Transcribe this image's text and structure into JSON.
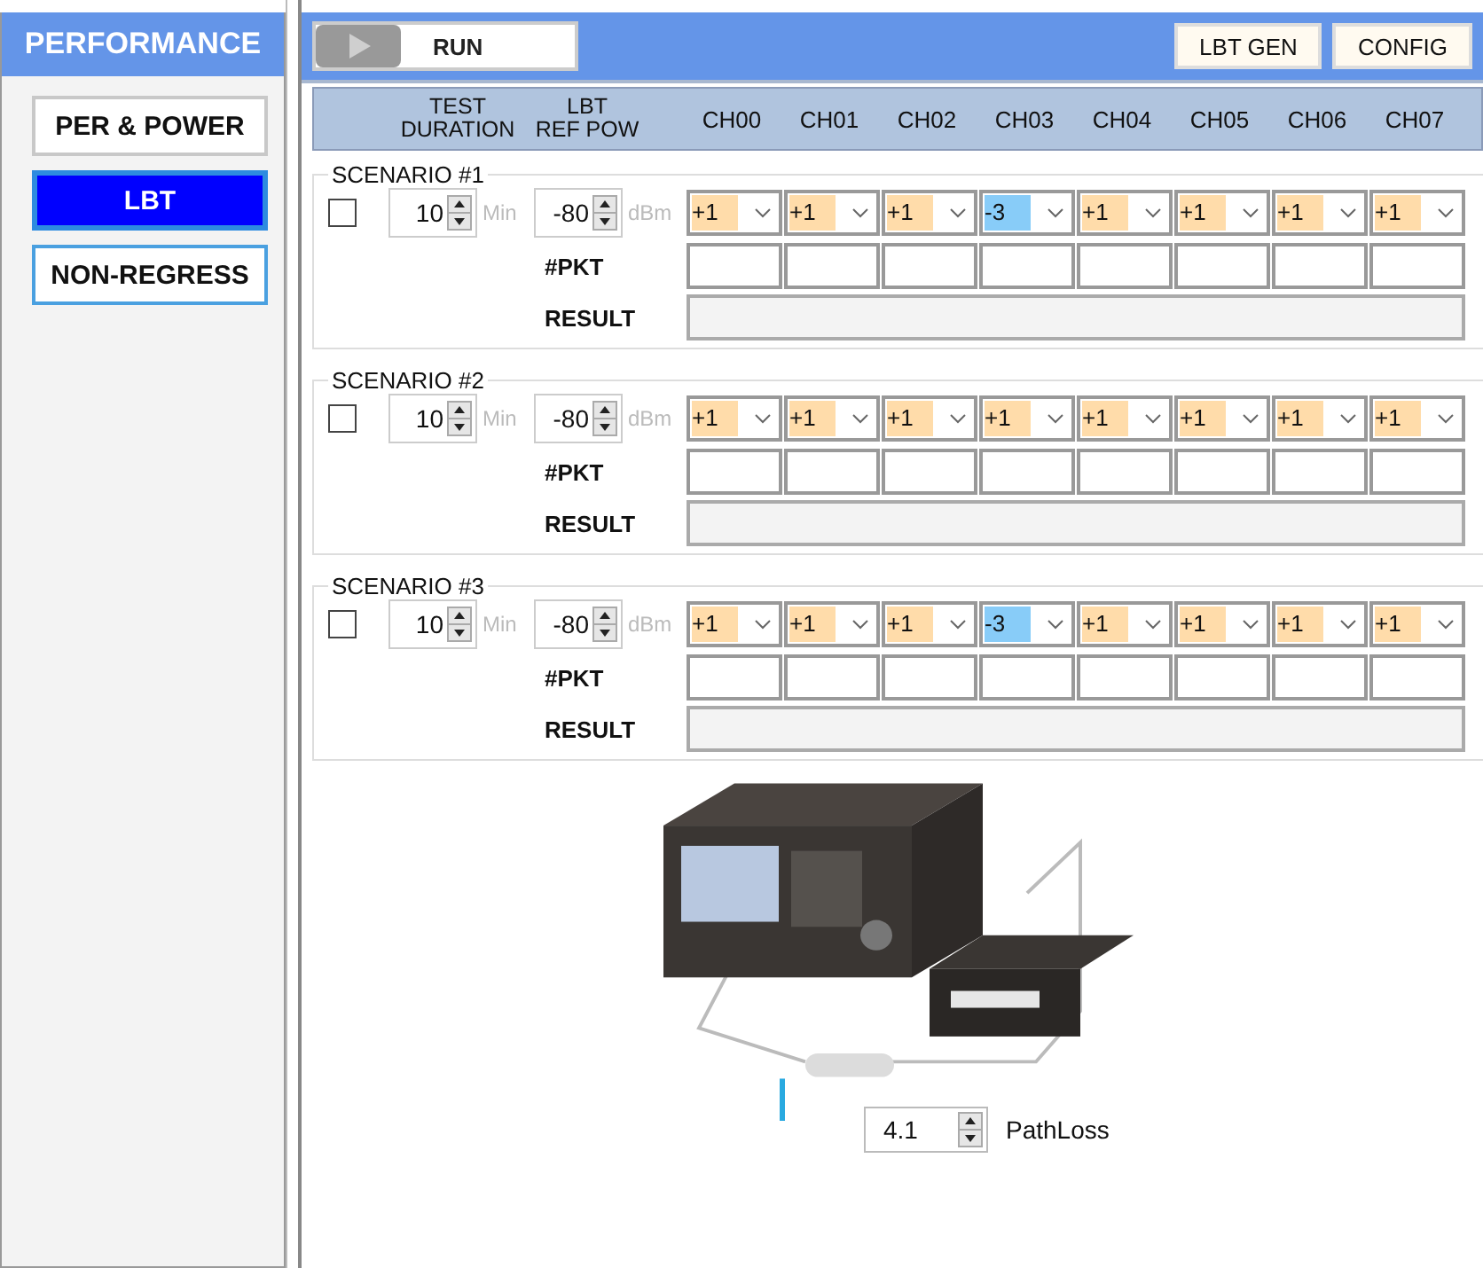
{
  "sidebar": {
    "title": "PERFORMANCE",
    "items": [
      {
        "label": "PER & POWER",
        "selected": false
      },
      {
        "label": "LBT",
        "selected": true
      },
      {
        "label": "NON-REGRESS",
        "selected": false
      }
    ]
  },
  "toolbar": {
    "run_label": "RUN",
    "buttons": [
      "LBT GEN",
      "CONFIG"
    ]
  },
  "header": {
    "duration": "TEST\nDURATION",
    "ref_pow": "LBT\nREF POW",
    "channels": [
      "CH00",
      "CH01",
      "CH02",
      "CH03",
      "CH04",
      "CH05",
      "CH06",
      "CH07"
    ]
  },
  "scenarios": [
    {
      "title": "SCENARIO #1",
      "checked": false,
      "duration": "10",
      "duration_unit": "Min",
      "ref_pow": "-80",
      "ref_unit": "dBm",
      "pkt_label": "#PKT",
      "result_label": "RESULT",
      "channels": [
        {
          "value": "+1",
          "color": "#ffdcaa"
        },
        {
          "value": "+1",
          "color": "#ffdcaa"
        },
        {
          "value": "+1",
          "color": "#ffdcaa"
        },
        {
          "value": "-3",
          "color": "#88ccf8"
        },
        {
          "value": "+1",
          "color": "#ffdcaa"
        },
        {
          "value": "+1",
          "color": "#ffdcaa"
        },
        {
          "value": "+1",
          "color": "#ffdcaa"
        },
        {
          "value": "+1",
          "color": "#ffdcaa"
        }
      ]
    },
    {
      "title": "SCENARIO #2",
      "checked": false,
      "duration": "10",
      "duration_unit": "Min",
      "ref_pow": "-80",
      "ref_unit": "dBm",
      "pkt_label": "#PKT",
      "result_label": "RESULT",
      "channels": [
        {
          "value": "+1",
          "color": "#ffdcaa"
        },
        {
          "value": "+1",
          "color": "#ffdcaa"
        },
        {
          "value": "+1",
          "color": "#ffdcaa"
        },
        {
          "value": "+1",
          "color": "#ffdcaa"
        },
        {
          "value": "+1",
          "color": "#ffdcaa"
        },
        {
          "value": "+1",
          "color": "#ffdcaa"
        },
        {
          "value": "+1",
          "color": "#ffdcaa"
        },
        {
          "value": "+1",
          "color": "#ffdcaa"
        }
      ]
    },
    {
      "title": "SCENARIO #3",
      "checked": false,
      "duration": "10",
      "duration_unit": "Min",
      "ref_pow": "-80",
      "ref_unit": "dBm",
      "pkt_label": "#PKT",
      "result_label": "RESULT",
      "channels": [
        {
          "value": "+1",
          "color": "#ffdcaa"
        },
        {
          "value": "+1",
          "color": "#ffdcaa"
        },
        {
          "value": "+1",
          "color": "#ffdcaa"
        },
        {
          "value": "-3",
          "color": "#88ccf8"
        },
        {
          "value": "+1",
          "color": "#ffdcaa"
        },
        {
          "value": "+1",
          "color": "#ffdcaa"
        },
        {
          "value": "+1",
          "color": "#ffdcaa"
        },
        {
          "value": "+1",
          "color": "#ffdcaa"
        }
      ]
    }
  ],
  "setup": {
    "kind": "picture",
    "pathloss": {
      "value": "4.1",
      "label": "PathLoss"
    }
  }
}
